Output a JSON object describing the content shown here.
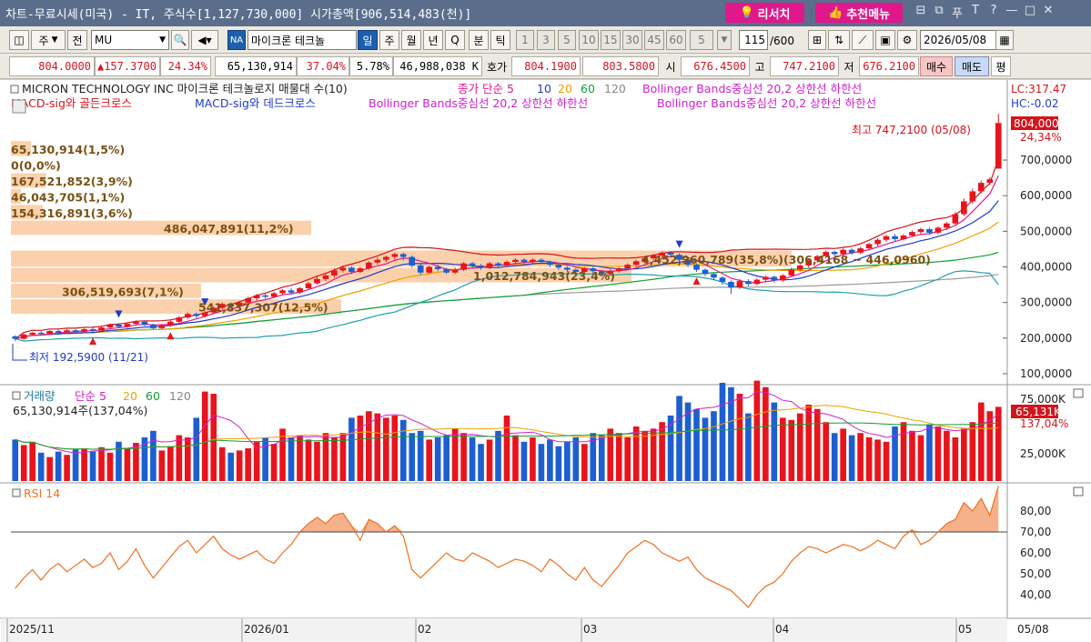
{
  "window": {
    "title": "차트-무료시세(미국) - IT, 주식수[1,127,730,000] 시가총액[906,514,483(천)]",
    "research_label": "리서치",
    "recommend_label": "추천메뉴",
    "controls": [
      "⊟",
      "⧉",
      "푸",
      "T",
      "?",
      "—",
      "□",
      "✕"
    ]
  },
  "toolbar": {
    "period_type": "주",
    "market": "전",
    "symbol": "MU",
    "na_badge": "NA",
    "stock_name": "마이크론 테크놀",
    "periods": [
      "일",
      "주",
      "월",
      "년",
      "Q",
      "분",
      "틱"
    ],
    "active_period": "일",
    "intervals": [
      "1",
      "3",
      "5",
      "10",
      "15",
      "30",
      "45",
      "60",
      "5"
    ],
    "count": "115",
    "count_total": "/600",
    "date": "2026/05/08"
  },
  "quote": {
    "price": "804.0000",
    "change": "▲157.3700",
    "change_pct": "24.34%",
    "volume": "65,130,914",
    "volume_pct": "37.04%",
    "turnover_pct": "5.78%",
    "amount": "46,988,038 K",
    "bidask_label": "호가",
    "ask": "804.1900",
    "bid": "803.5800",
    "open_label": "시",
    "open": "676.4500",
    "high_label": "고",
    "high": "747.2100",
    "low_label": "저",
    "low": "676.2100",
    "buy_label": "매수",
    "sell_label": "매도",
    "eval_label": "평"
  },
  "chart_data": [
    {
      "type": "candlestick",
      "title": "MICRON TECHNOLOGY INC  마이크론 테크놀로지 매물대 수(10)",
      "legend": [
        {
          "name": "종가 단순 5",
          "color": "#e0188c"
        },
        {
          "name": "10",
          "color": "#1d3cc8"
        },
        {
          "name": "20",
          "color": "#f0a000"
        },
        {
          "name": "60",
          "color": "#10a030"
        },
        {
          "name": "120",
          "color": "#888888"
        },
        {
          "name": "Bollinger Bands중심선 20,2  상한선  하한선",
          "color": "#d020d0"
        },
        {
          "name": "MACD-sig와 골든크로스",
          "color": "#d4141c"
        },
        {
          "name": "MACD-sig와 데드크로스",
          "color": "#1d3cc8"
        },
        {
          "name": "Bollinger Bands중심선 20,2  상한선  하한선",
          "color": "#d020d0"
        },
        {
          "name": "Bollinger Bands중심선 20,2  상한선  하한선",
          "color": "#d020d0"
        }
      ],
      "lc": "LC:317.47",
      "hc": "HC:-0.02",
      "y_axis": [
        "100,0000",
        "200,0000",
        "300,0000",
        "400,0000",
        "500,0000",
        "600,0000",
        "700,0000"
      ],
      "ylim": [
        90,
        830
      ],
      "last_price_label": "804,0000",
      "last_pct_label": "24,34%",
      "high_annotation": "최고 747,2100 (05/08)",
      "low_annotation": "최저 192,5900 (11/21)",
      "x_axis": [
        "2025/11",
        "2026/01",
        "02",
        "03",
        "04",
        "05",
        "05/08"
      ],
      "volume_profile": [
        {
          "label": "65,130,914(1,5%)",
          "price_low": 709,
          "price_high": 753,
          "frac": 0.02
        },
        {
          "label": "0(0,0%)",
          "price_low": 664,
          "price_high": 708,
          "frac": 0.0
        },
        {
          "label": "167,521,852(3,9%)",
          "price_low": 620,
          "price_high": 663,
          "frac": 0.035
        },
        {
          "label": "46,043,705(1,1%)",
          "price_low": 575,
          "price_high": 619,
          "frac": 0.01
        },
        {
          "label": "154,316,891(3,6%)",
          "price_low": 531,
          "price_high": 574,
          "frac": 0.032
        },
        {
          "label": "486,047,891(11,2%)",
          "price_low": 487,
          "price_high": 530,
          "frac": 0.3
        },
        {
          "label": "4,452,960,789(35,8%)(306,4168 ~ 446,0960)",
          "price_low": 398,
          "price_high": 446,
          "frac": 0.78
        },
        {
          "label": "1,012,784,943(23,4%)",
          "price_low": 354,
          "price_high": 397,
          "frac": 0.62
        },
        {
          "label": "306,519,693(7,1%)",
          "price_low": 310,
          "price_high": 353,
          "frac": 0.19
        },
        {
          "label": "541,837,307(12,5%)",
          "price_low": 266,
          "price_high": 309,
          "frac": 0.33
        }
      ],
      "candles": [
        [
          205,
          198,
          192,
          208
        ],
        [
          198,
          210,
          195,
          213
        ],
        [
          210,
          215,
          206,
          218
        ],
        [
          215,
          212,
          208,
          219
        ],
        [
          212,
          220,
          209,
          223
        ],
        [
          220,
          216,
          212,
          224
        ],
        [
          216,
          222,
          213,
          226
        ],
        [
          222,
          218,
          214,
          225
        ],
        [
          218,
          225,
          215,
          228
        ],
        [
          225,
          221,
          217,
          229
        ],
        [
          221,
          230,
          218,
          233
        ],
        [
          230,
          238,
          226,
          241
        ],
        [
          238,
          232,
          228,
          242
        ],
        [
          232,
          240,
          229,
          244
        ],
        [
          240,
          246,
          236,
          250
        ],
        [
          246,
          238,
          234,
          248
        ],
        [
          238,
          228,
          224,
          241
        ],
        [
          228,
          236,
          225,
          240
        ],
        [
          236,
          246,
          232,
          250
        ],
        [
          246,
          258,
          242,
          262
        ],
        [
          258,
          268,
          254,
          272
        ],
        [
          268,
          262,
          256,
          272
        ],
        [
          262,
          272,
          258,
          276
        ],
        [
          272,
          285,
          268,
          290
        ],
        [
          285,
          296,
          280,
          300
        ],
        [
          296,
          290,
          284,
          300
        ],
        [
          290,
          300,
          286,
          305
        ],
        [
          300,
          312,
          296,
          316
        ],
        [
          312,
          320,
          306,
          324
        ],
        [
          320,
          316,
          310,
          326
        ],
        [
          316,
          326,
          312,
          330
        ],
        [
          326,
          334,
          320,
          338
        ],
        [
          334,
          328,
          322,
          340
        ],
        [
          328,
          340,
          324,
          344
        ],
        [
          340,
          354,
          336,
          358
        ],
        [
          354,
          366,
          350,
          372
        ],
        [
          366,
          376,
          360,
          382
        ],
        [
          376,
          390,
          370,
          396
        ],
        [
          390,
          398,
          384,
          404
        ],
        [
          398,
          386,
          380,
          402
        ],
        [
          386,
          396,
          382,
          400
        ],
        [
          396,
          412,
          392,
          416
        ],
        [
          412,
          420,
          406,
          426
        ],
        [
          420,
          428,
          414,
          432
        ],
        [
          428,
          436,
          420,
          440
        ],
        [
          436,
          428,
          418,
          440
        ],
        [
          428,
          404,
          398,
          432
        ],
        [
          404,
          384,
          378,
          408
        ],
        [
          384,
          400,
          380,
          404
        ],
        [
          400,
          394,
          388,
          406
        ],
        [
          394,
          384,
          380,
          398
        ],
        [
          384,
          392,
          380,
          398
        ],
        [
          392,
          410,
          388,
          414
        ],
        [
          410,
          404,
          398,
          414
        ],
        [
          404,
          398,
          392,
          408
        ],
        [
          398,
          410,
          394,
          414
        ],
        [
          410,
          404,
          398,
          414
        ],
        [
          404,
          414,
          400,
          418
        ],
        [
          414,
          420,
          408,
          424
        ],
        [
          420,
          414,
          408,
          424
        ],
        [
          414,
          420,
          410,
          424
        ],
        [
          420,
          414,
          408,
          424
        ],
        [
          414,
          406,
          400,
          418
        ],
        [
          406,
          398,
          392,
          410
        ],
        [
          398,
          392,
          386,
          402
        ],
        [
          392,
          386,
          380,
          396
        ],
        [
          386,
          396,
          382,
          400
        ],
        [
          396,
          388,
          382,
          400
        ],
        [
          388,
          380,
          374,
          392
        ],
        [
          380,
          388,
          376,
          394
        ],
        [
          388,
          396,
          384,
          400
        ],
        [
          396,
          406,
          392,
          410
        ],
        [
          406,
          416,
          400,
          420
        ],
        [
          416,
          424,
          410,
          428
        ],
        [
          424,
          432,
          418,
          436
        ],
        [
          432,
          440,
          426,
          444
        ],
        [
          440,
          434,
          428,
          444
        ],
        [
          434,
          420,
          412,
          438
        ],
        [
          420,
          406,
          400,
          424
        ],
        [
          406,
          392,
          386,
          410
        ],
        [
          392,
          380,
          374,
          396
        ],
        [
          380,
          370,
          364,
          384
        ],
        [
          370,
          358,
          350,
          374
        ],
        [
          358,
          342,
          324,
          362
        ],
        [
          342,
          360,
          338,
          366
        ],
        [
          360,
          352,
          346,
          366
        ],
        [
          352,
          364,
          348,
          368
        ],
        [
          364,
          372,
          358,
          376
        ],
        [
          372,
          362,
          356,
          376
        ],
        [
          362,
          376,
          358,
          380
        ],
        [
          376,
          392,
          372,
          398
        ],
        [
          392,
          404,
          388,
          408
        ],
        [
          404,
          418,
          398,
          422
        ],
        [
          418,
          430,
          412,
          434
        ],
        [
          430,
          442,
          424,
          446
        ],
        [
          442,
          436,
          430,
          446
        ],
        [
          436,
          448,
          432,
          452
        ],
        [
          448,
          440,
          434,
          452
        ],
        [
          440,
          452,
          436,
          456
        ],
        [
          452,
          464,
          446,
          468
        ],
        [
          464,
          476,
          458,
          480
        ],
        [
          476,
          486,
          470,
          490
        ],
        [
          486,
          478,
          472,
          492
        ],
        [
          478,
          488,
          474,
          492
        ],
        [
          488,
          498,
          484,
          502
        ],
        [
          498,
          506,
          492,
          510
        ],
        [
          506,
          496,
          490,
          510
        ],
        [
          496,
          510,
          492,
          514
        ],
        [
          510,
          522,
          504,
          526
        ],
        [
          522,
          548,
          518,
          554
        ],
        [
          548,
          584,
          542,
          592
        ],
        [
          584,
          612,
          578,
          620
        ],
        [
          612,
          636,
          606,
          642
        ],
        [
          636,
          646,
          630,
          652
        ],
        [
          676,
          804,
          676,
          830
        ]
      ]
    },
    {
      "type": "bar",
      "title": "거래량",
      "legend": [
        {
          "name": "단순 5",
          "color": "#d020d0"
        },
        {
          "name": "20",
          "color": "#f0a000"
        },
        {
          "name": "60",
          "color": "#10a030"
        },
        {
          "name": "120",
          "color": "#888888"
        }
      ],
      "summary": "65,130,914주(137,04%)",
      "y_axis": [
        "25,000K",
        "75,000K"
      ],
      "last_label": "65,131K",
      "last_pct": "137,04%",
      "volumes_k": [
        38,
        33,
        36,
        26,
        22,
        27,
        24,
        29,
        30,
        27,
        31,
        26,
        36,
        30,
        35,
        40,
        46,
        28,
        32,
        42,
        40,
        58,
        82,
        80,
        31,
        26,
        28,
        30,
        36,
        40,
        34,
        48,
        40,
        42,
        38,
        36,
        44,
        40,
        44,
        58,
        60,
        64,
        62,
        58,
        60,
        56,
        44,
        46,
        38,
        40,
        42,
        48,
        44,
        40,
        34,
        38,
        46,
        60,
        42,
        36,
        40,
        34,
        38,
        32,
        36,
        40,
        34,
        44,
        42,
        48,
        44,
        40,
        50,
        46,
        48,
        54,
        60,
        78,
        72,
        66,
        58,
        64,
        90,
        86,
        80,
        62,
        92,
        86,
        72,
        58,
        56,
        62,
        70,
        66,
        54,
        44,
        48,
        42,
        44,
        40,
        38,
        36,
        50,
        54,
        46,
        42,
        52,
        50,
        46,
        40,
        48,
        54,
        72,
        64,
        68
      ]
    },
    {
      "type": "line",
      "title": "RSI 14",
      "y_axis": [
        "40,00",
        "50,00",
        "60,00",
        "70,00",
        "80,00"
      ],
      "ylim": [
        28,
        92
      ],
      "reference": 70,
      "values": [
        43,
        48,
        52,
        47,
        52,
        55,
        51,
        54,
        57,
        53,
        55,
        60,
        52,
        56,
        62,
        54,
        48,
        53,
        58,
        63,
        66,
        60,
        64,
        68,
        62,
        59,
        57,
        59,
        61,
        57,
        55,
        60,
        64,
        70,
        74,
        77,
        74,
        78,
        79,
        73,
        66,
        76,
        74,
        70,
        73,
        68,
        52,
        48,
        52,
        56,
        60,
        57,
        56,
        60,
        58,
        56,
        53,
        55,
        57,
        56,
        54,
        51,
        57,
        54,
        50,
        47,
        53,
        47,
        44,
        49,
        54,
        60,
        63,
        66,
        64,
        60,
        58,
        56,
        58,
        52,
        48,
        46,
        44,
        42,
        38,
        34,
        40,
        44,
        46,
        50,
        56,
        60,
        63,
        62,
        60,
        62,
        64,
        63,
        61,
        63,
        66,
        64,
        62,
        68,
        71,
        64,
        66,
        70,
        74,
        76,
        84,
        80,
        86,
        78,
        92
      ]
    }
  ]
}
